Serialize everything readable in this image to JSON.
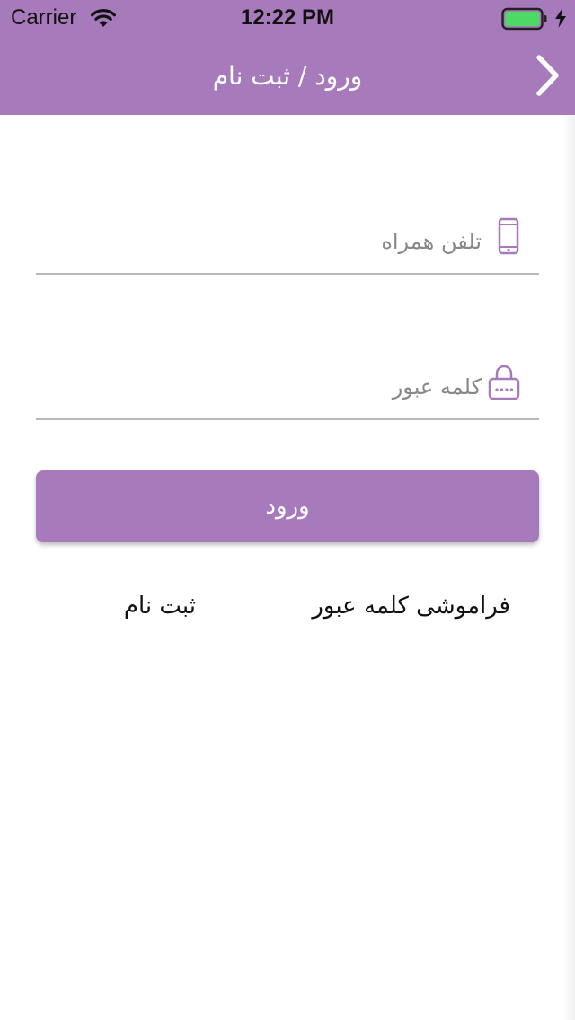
{
  "status_bar": {
    "carrier": "Carrier",
    "time": "12:22 PM",
    "wifi_icon": "wifi-icon",
    "battery_icon": "battery-icon",
    "charging_icon": "charging-bolt-icon"
  },
  "nav": {
    "title": "ورود / ثبت نام",
    "back_icon": "chevron-right-icon"
  },
  "form": {
    "phone": {
      "placeholder": "تلفن همراه",
      "value": "",
      "icon": "mobile-phone-icon"
    },
    "password": {
      "placeholder": "کلمه عبور",
      "value": "",
      "icon": "lock-icon"
    },
    "login_label": "ورود"
  },
  "links": {
    "forgot_password": "فراموشی کلمه عبور",
    "register": "ثبت نام"
  },
  "colors": {
    "primary": "#a77bbb",
    "text": "#111111",
    "placeholder": "#888888",
    "underline": "#b8b8b8",
    "battery_fill": "#4cd964"
  }
}
